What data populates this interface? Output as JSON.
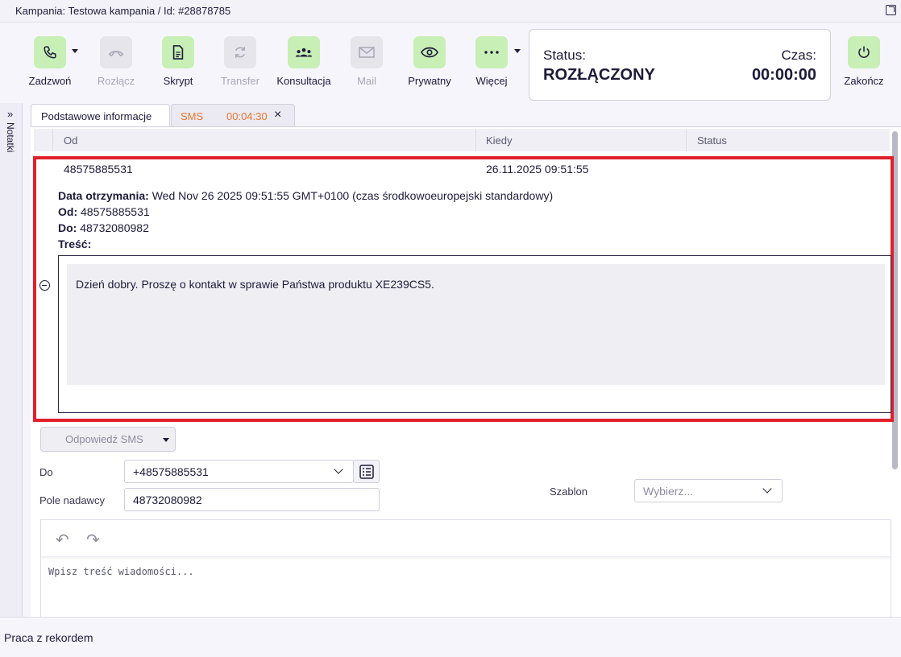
{
  "window": {
    "title": "Kampania: Testowa kampania / Id: #28878785"
  },
  "toolbar": {
    "call": "Zadzwoń",
    "hangup": "Rozłącz",
    "script": "Skrypt",
    "transfer": "Transfer",
    "consult": "Konsultacja",
    "mail": "Mail",
    "private": "Prywatny",
    "more": "Więcej",
    "finish": "Zakończ"
  },
  "status": {
    "status_label": "Status:",
    "status_value": "ROZŁĄCZONY",
    "time_label": "Czas:",
    "time_value": "00:00:00"
  },
  "notes": {
    "label": "Notatki"
  },
  "tabs": [
    {
      "label": "Podstawowe informacje"
    },
    {
      "label": "SMS",
      "timer": "00:04:30"
    }
  ],
  "table": {
    "headers": [
      "Od",
      "Kiedy",
      "Status"
    ],
    "row": {
      "from": "48575885531",
      "when": "26.11.2025 09:51:55",
      "status": ""
    }
  },
  "details": {
    "received_label": "Data otrzymania:",
    "received_value": "Wed Nov 26 2025 09:51:55 GMT+0100 (czas środkowoeuropejski standardowy)",
    "from_label": "Od:",
    "from_value": "48575885531",
    "to_label": "Do:",
    "to_value": "48732080982",
    "content_label": "Treść:",
    "message": "Dzień dobry. Proszę o kontakt w sprawie Państwa produktu XE239CS5."
  },
  "reply": {
    "button": "Odpowiedź SMS",
    "to_label": "Do",
    "to_value": "+48575885531",
    "sender_label": "Pole nadawcy",
    "sender_value": "48732080982",
    "template_label": "Szablon",
    "template_placeholder": "Wybierz...",
    "editor_placeholder": "Wpisz treść wiadomości..."
  },
  "footer": {
    "label": "Praca z rekordem"
  },
  "colors": {
    "highlight": "#e0202a",
    "accent_green": "#c8efb6",
    "sms_tab_text": "#e8762e"
  }
}
